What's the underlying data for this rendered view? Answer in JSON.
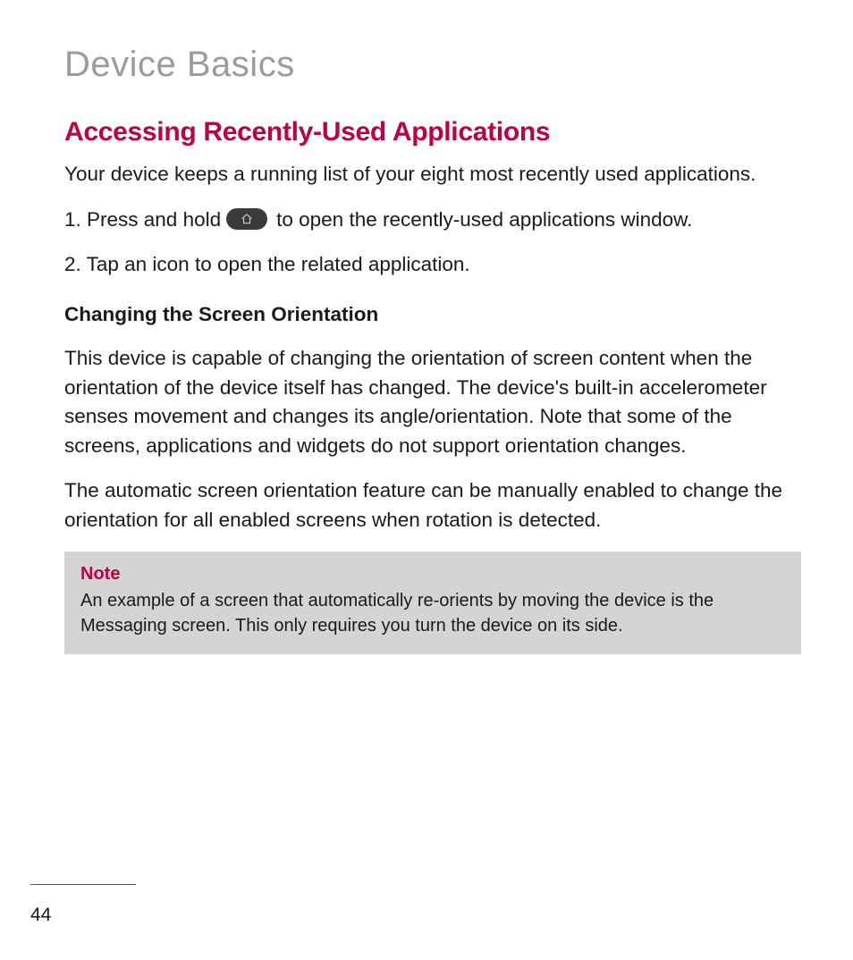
{
  "header": {
    "page_title": "Device Basics"
  },
  "section": {
    "title": "Accessing Recently-Used Applications",
    "intro": "Your device keeps a running list of your eight most recently used applications."
  },
  "steps": {
    "s1_before": "1. Press and hold ",
    "s1_after": " to open the recently-used applications window.",
    "s2": "2. Tap an icon to open the related application."
  },
  "subsection": {
    "heading": "Changing the Screen Orientation",
    "p1": "This device is capable of changing the orientation of screen content when the orientation of the device itself has changed. The device's built-in accelerometer senses movement and changes its angle/orientation. Note that some of the screens, applications and widgets do not support orientation changes.",
    "p2": "The automatic screen orientation feature can be manually enabled to change the orientation for all enabled screens when rotation is detected."
  },
  "note": {
    "label": "Note",
    "text": "An example of a screen that automatically re-orients by moving the device is the Messaging screen. This only requires you turn the device on its side."
  },
  "footer": {
    "page_number": "44"
  }
}
